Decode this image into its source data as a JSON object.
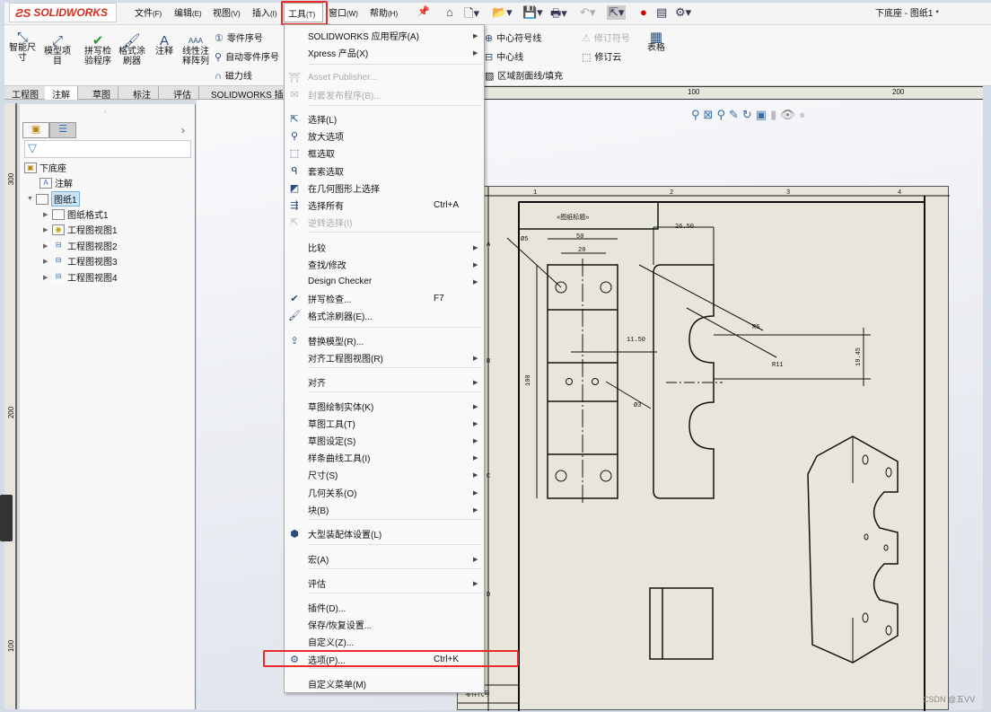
{
  "app": {
    "brand": "SOLIDWORKS",
    "doc_title": "下底座 - 图纸1 *"
  },
  "menubar": [
    {
      "label": "文件",
      "key": "(F)"
    },
    {
      "label": "编辑",
      "key": "(E)"
    },
    {
      "label": "视图",
      "key": "(V)"
    },
    {
      "label": "插入",
      "key": "(I)"
    },
    {
      "label": "工具",
      "key": "(T)"
    },
    {
      "label": "窗口",
      "key": "(W)"
    },
    {
      "label": "帮助",
      "key": "(H)"
    }
  ],
  "ribbon": {
    "big": [
      "智能尺寸",
      "模型项目",
      "拼写检验程序",
      "格式涂刷器",
      "注释",
      "线性注释阵列",
      "表格"
    ],
    "small": [
      "零件序号",
      "自动零件序号",
      "磁力线",
      "中心符号线",
      "中心线",
      "区域剖面线/填充",
      "修订符号",
      "修订云"
    ]
  },
  "tabs": [
    "工程图",
    "注解",
    "草图",
    "标注",
    "评估",
    "SOLIDWORKS 插件"
  ],
  "active_tab": "注解",
  "rulers": {
    "h": [
      "100",
      "200"
    ],
    "v": [
      "300",
      "200",
      "100"
    ]
  },
  "tree": {
    "root": "下底座",
    "items": [
      {
        "label": "注解",
        "icon": "annotation-icon"
      },
      {
        "label": "图纸1",
        "icon": "sheet-icon"
      },
      {
        "label": "图纸格式1",
        "icon": "sheet-format-icon"
      },
      {
        "label": "工程图视图1",
        "icon": "drawing-view-icon"
      },
      {
        "label": "工程图视图2",
        "icon": "drawing-view-icon"
      },
      {
        "label": "工程图视图3",
        "icon": "drawing-view-icon"
      },
      {
        "label": "工程图视图4",
        "icon": "drawing-view-icon"
      }
    ]
  },
  "tools_menu": [
    {
      "label": "SOLIDWORKS 应用程序(A)",
      "sub": true
    },
    {
      "label": "Xpress 产品(X)",
      "sub": true
    },
    {
      "label": "Asset Publisher...",
      "disabled": true,
      "icon": "asset-publisher-icon"
    },
    {
      "label": "封套发布程序(B)...",
      "disabled": true,
      "icon": "envelope-icon"
    },
    {
      "label": "选择(L)",
      "icon": "select-arrow-icon"
    },
    {
      "label": "放大选项",
      "icon": "magnify-select-icon"
    },
    {
      "label": "框选取",
      "icon": "box-select-icon"
    },
    {
      "label": "套索选取",
      "icon": "lasso-icon"
    },
    {
      "label": "在几何图形上选择",
      "icon": "select-geometry-icon"
    },
    {
      "label": "选择所有",
      "shortcut": "Ctrl+A",
      "icon": "select-all-icon"
    },
    {
      "label": "逆转选择(I)",
      "disabled": true,
      "icon": "invert-select-icon"
    },
    {
      "label": "比较",
      "sub": true
    },
    {
      "label": "查找/修改",
      "sub": true
    },
    {
      "label": "Design Checker",
      "sub": true
    },
    {
      "label": "拼写检查...",
      "shortcut": "F7",
      "icon": "spell-check-icon"
    },
    {
      "label": "格式涂刷器(E)...",
      "icon": "format-painter-icon"
    },
    {
      "label": "替换模型(R)...",
      "icon": "replace-model-icon"
    },
    {
      "label": "对齐工程图视图(R)",
      "sub": true
    },
    {
      "label": "对齐",
      "sub": true
    },
    {
      "label": "草图绘制实体(K)",
      "sub": true
    },
    {
      "label": "草图工具(T)",
      "sub": true
    },
    {
      "label": "草图设定(S)",
      "sub": true
    },
    {
      "label": "样条曲线工具(I)",
      "sub": true
    },
    {
      "label": "尺寸(S)",
      "sub": true
    },
    {
      "label": "几何关系(O)",
      "sub": true
    },
    {
      "label": "块(B)",
      "sub": true
    },
    {
      "label": "大型装配体设置(L)",
      "icon": "large-assembly-icon"
    },
    {
      "label": "宏(A)",
      "sub": true
    },
    {
      "label": "评估",
      "sub": true
    },
    {
      "label": "插件(D)..."
    },
    {
      "label": "保存/恢复设置..."
    },
    {
      "label": "自定义(Z)..."
    },
    {
      "label": "选项(P)...",
      "shortcut": "Ctrl+K",
      "icon": "gear-icon"
    },
    {
      "label": "自定义菜单(M)"
    }
  ],
  "drawing": {
    "zones_top": [
      "1",
      "2",
      "3",
      "4"
    ],
    "zones_side": [
      "A",
      "B",
      "C",
      "D"
    ],
    "title_block": "«图纸标题»",
    "dims": [
      "50",
      "20",
      "100",
      "11.50",
      "Ø5",
      "Ø3",
      "26.50",
      "R5",
      "R11",
      "19.45"
    ],
    "bottom_label": "零件代号"
  },
  "watermark": "CSDN @五VV"
}
